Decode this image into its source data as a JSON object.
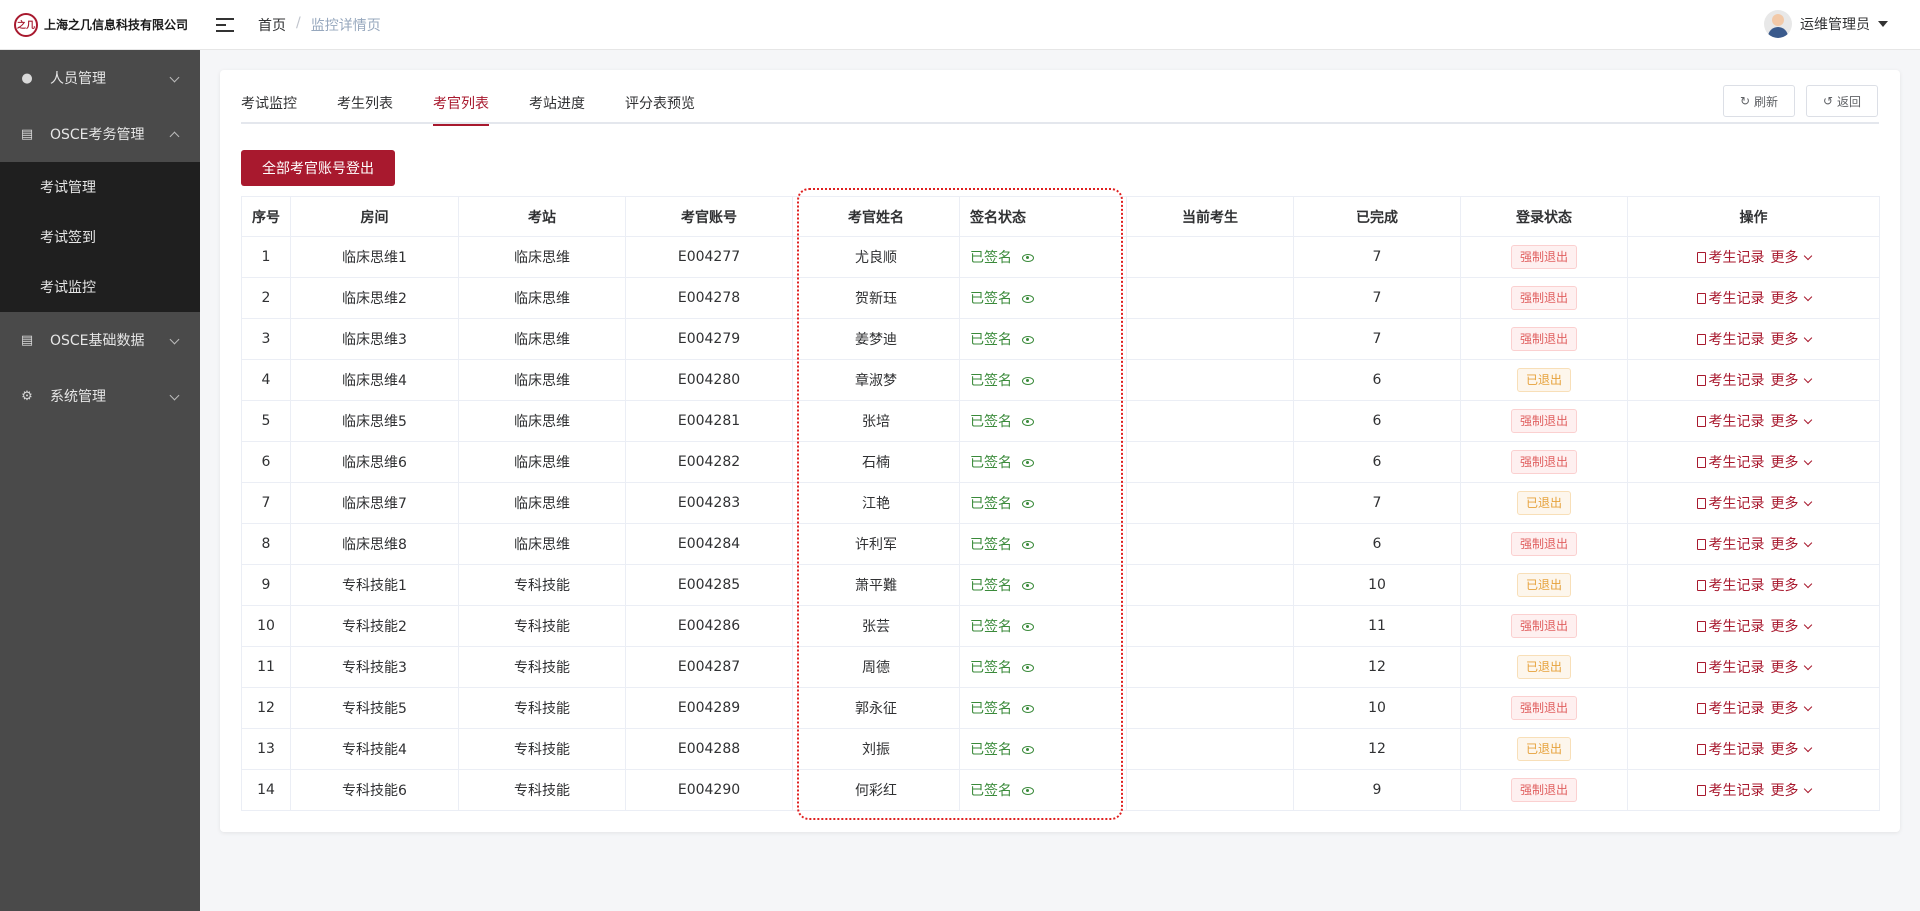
{
  "header": {
    "logo_mark": "之几",
    "company": "上海之几信息科技有限公司",
    "breadcrumb_home": "首页",
    "breadcrumb_sep": "/",
    "breadcrumb_current": "监控详情页",
    "user_name": "运维管理员"
  },
  "sidebar": {
    "items": [
      {
        "label": "人员管理",
        "icon": "user-icon"
      },
      {
        "label": "OSCE考务管理",
        "icon": "document-icon"
      },
      {
        "label": "OSCE基础数据",
        "icon": "database-icon"
      },
      {
        "label": "系统管理",
        "icon": "gear-icon"
      }
    ],
    "sub": [
      "考试管理",
      "考试签到",
      "考试监控"
    ]
  },
  "tabs": [
    "考试监控",
    "考生列表",
    "考官列表",
    "考站进度",
    "评分表预览"
  ],
  "active_tab": 2,
  "buttons": {
    "refresh": "刷新",
    "back": "返回",
    "logout_all": "全部考官账号登出"
  },
  "table": {
    "headers": [
      "序号",
      "房间",
      "考站",
      "考官账号",
      "考官姓名",
      "签名状态",
      "当前考生",
      "已完成",
      "登录状态",
      "操作"
    ],
    "action_record": "考生记录",
    "action_more": "更多",
    "rows": [
      {
        "no": "1",
        "room": "临床思维1",
        "station": "临床思维",
        "account": "E004277",
        "name": "尤良顺",
        "sign": "已签名",
        "current": "",
        "done": "7",
        "login": "强制退出",
        "login_type": "force"
      },
      {
        "no": "2",
        "room": "临床思维2",
        "station": "临床思维",
        "account": "E004278",
        "name": "贺新珏",
        "sign": "已签名",
        "current": "",
        "done": "7",
        "login": "强制退出",
        "login_type": "force"
      },
      {
        "no": "3",
        "room": "临床思维3",
        "station": "临床思维",
        "account": "E004279",
        "name": "姜梦迪",
        "sign": "已签名",
        "current": "",
        "done": "7",
        "login": "强制退出",
        "login_type": "force"
      },
      {
        "no": "4",
        "room": "临床思维4",
        "station": "临床思维",
        "account": "E004280",
        "name": "章淑梦",
        "sign": "已签名",
        "current": "",
        "done": "6",
        "login": "已退出",
        "login_type": "out"
      },
      {
        "no": "5",
        "room": "临床思维5",
        "station": "临床思维",
        "account": "E004281",
        "name": "张培",
        "sign": "已签名",
        "current": "",
        "done": "6",
        "login": "强制退出",
        "login_type": "force"
      },
      {
        "no": "6",
        "room": "临床思维6",
        "station": "临床思维",
        "account": "E004282",
        "name": "石楠",
        "sign": "已签名",
        "current": "",
        "done": "6",
        "login": "强制退出",
        "login_type": "force"
      },
      {
        "no": "7",
        "room": "临床思维7",
        "station": "临床思维",
        "account": "E004283",
        "name": "江艳",
        "sign": "已签名",
        "current": "",
        "done": "7",
        "login": "已退出",
        "login_type": "out"
      },
      {
        "no": "8",
        "room": "临床思维8",
        "station": "临床思维",
        "account": "E004284",
        "name": "许利军",
        "sign": "已签名",
        "current": "",
        "done": "6",
        "login": "强制退出",
        "login_type": "force"
      },
      {
        "no": "9",
        "room": "专科技能1",
        "station": "专科技能",
        "account": "E004285",
        "name": "萧平難",
        "sign": "已签名",
        "current": "",
        "done": "10",
        "login": "已退出",
        "login_type": "out"
      },
      {
        "no": "10",
        "room": "专科技能2",
        "station": "专科技能",
        "account": "E004286",
        "name": "张芸",
        "sign": "已签名",
        "current": "",
        "done": "11",
        "login": "强制退出",
        "login_type": "force"
      },
      {
        "no": "11",
        "room": "专科技能3",
        "station": "专科技能",
        "account": "E004287",
        "name": "周德",
        "sign": "已签名",
        "current": "",
        "done": "12",
        "login": "已退出",
        "login_type": "out"
      },
      {
        "no": "12",
        "room": "专科技能5",
        "station": "专科技能",
        "account": "E004289",
        "name": "郭永征",
        "sign": "已签名",
        "current": "",
        "done": "10",
        "login": "强制退出",
        "login_type": "force"
      },
      {
        "no": "13",
        "room": "专科技能4",
        "station": "专科技能",
        "account": "E004288",
        "name": "刘振",
        "sign": "已签名",
        "current": "",
        "done": "12",
        "login": "已退出",
        "login_type": "out"
      },
      {
        "no": "14",
        "room": "专科技能6",
        "station": "专科技能",
        "account": "E004290",
        "name": "何彩红",
        "sign": "已签名",
        "current": "",
        "done": "9",
        "login": "强制退出",
        "login_type": "force"
      }
    ]
  },
  "colors": {
    "brand": "#a8192e",
    "signed": "#3a8a3a",
    "sidebar_bg": "#4a4a4a",
    "submenu_bg": "#1f1f1f"
  }
}
